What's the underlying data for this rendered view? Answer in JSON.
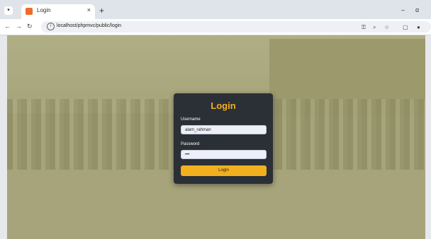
{
  "browser": {
    "tab_title": "Login",
    "tab_close": "×",
    "new_tab": "+",
    "url": "localhost/phpmvc/public/login",
    "win_minimize": "–",
    "win_restore": "ɑ",
    "nav_back": "←",
    "nav_forward": "→",
    "nav_reload": "↻"
  },
  "login": {
    "title": "Login",
    "username_label": "Username",
    "username_value": "alam_rahman",
    "password_label": "Password",
    "password_value": "•••",
    "submit_label": "Login"
  },
  "colors": {
    "accent": "#f2b01e",
    "card": "#2b2f36"
  }
}
